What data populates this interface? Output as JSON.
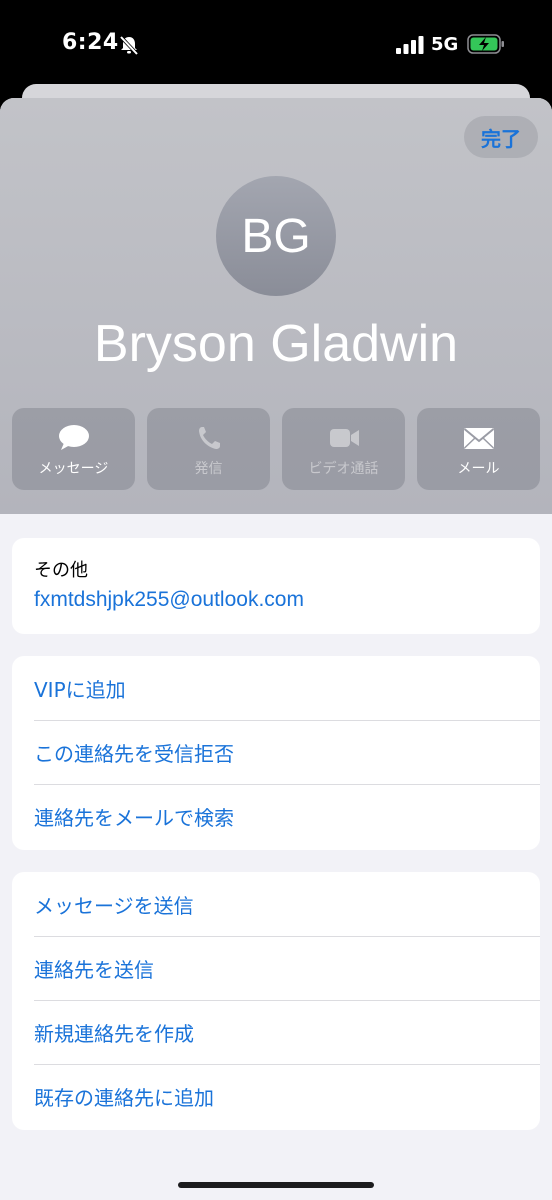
{
  "status_bar": {
    "time": "6:24",
    "network": "5G",
    "icons": [
      "silent-bell-icon",
      "cellular-signal-icon",
      "battery-charging-icon"
    ]
  },
  "header": {
    "done_label": "完了",
    "avatar_initials": "BG",
    "name": "Bryson Gladwin"
  },
  "actions": [
    {
      "label": "メッセージ",
      "icon": "message-bubble-icon",
      "enabled": true
    },
    {
      "label": "発信",
      "icon": "phone-icon",
      "enabled": false
    },
    {
      "label": "ビデオ通話",
      "icon": "video-camera-icon",
      "enabled": false
    },
    {
      "label": "メール",
      "icon": "mail-envelope-icon",
      "enabled": true
    }
  ],
  "other_section": {
    "label": "その他",
    "email": "fxmtdshjpk255@outlook.com"
  },
  "list1": [
    "VIPに追加",
    "この連絡先を受信拒否",
    "連絡先をメールで検索"
  ],
  "list2": [
    "メッセージを送信",
    "連絡先を送信",
    "新規連絡先を作成",
    "既存の連絡先に追加"
  ],
  "colors": {
    "accent": "#1a73d9",
    "header_bg": "#bbbcc3",
    "page_bg": "#f2f2f7"
  }
}
